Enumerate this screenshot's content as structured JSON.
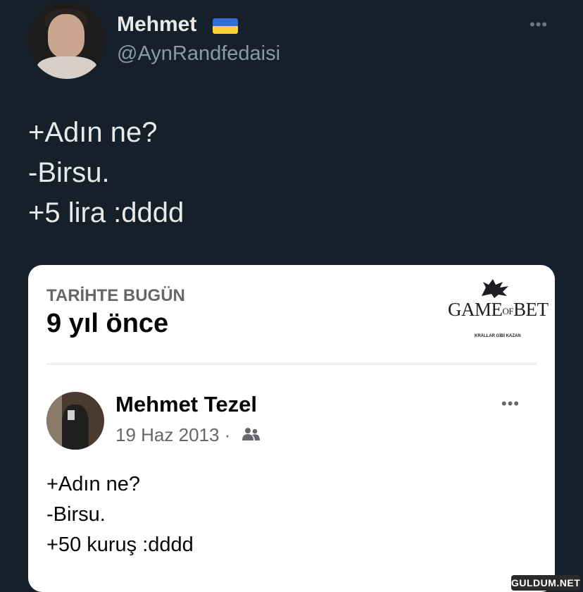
{
  "tweet": {
    "author_name": "Mehmet",
    "handle": "@AynRandfedaisi",
    "more": "•••",
    "lines": [
      "+Adın ne?",
      "-Birsu.",
      "+5 lira :dddd"
    ]
  },
  "card": {
    "section_label": "TARİHTE BUGÜN",
    "years_ago": "9 yıl önce",
    "logo": {
      "brand_part1": "GAME",
      "brand_of": "OF",
      "brand_part2": "BET",
      "tagline": "KRALLAR GİBİ KAZAN"
    },
    "post": {
      "author": "Mehmet Tezel",
      "date": "19 Haz 2013 ·",
      "more": "•••",
      "lines": [
        "+Adın ne?",
        "-Birsu.",
        "+50 kuruş :dddd"
      ]
    }
  },
  "watermark": "GULDUM.NET",
  "colors": {
    "background": "#15202b",
    "card": "#ffffff",
    "secondary_text": "#8b98a5",
    "flag_blue": "#2f6fd3",
    "flag_yellow": "#f7d236"
  },
  "icons": [
    "ukraine-flag-icon",
    "more-icon",
    "wolf-logo-icon",
    "friends-icon"
  ]
}
